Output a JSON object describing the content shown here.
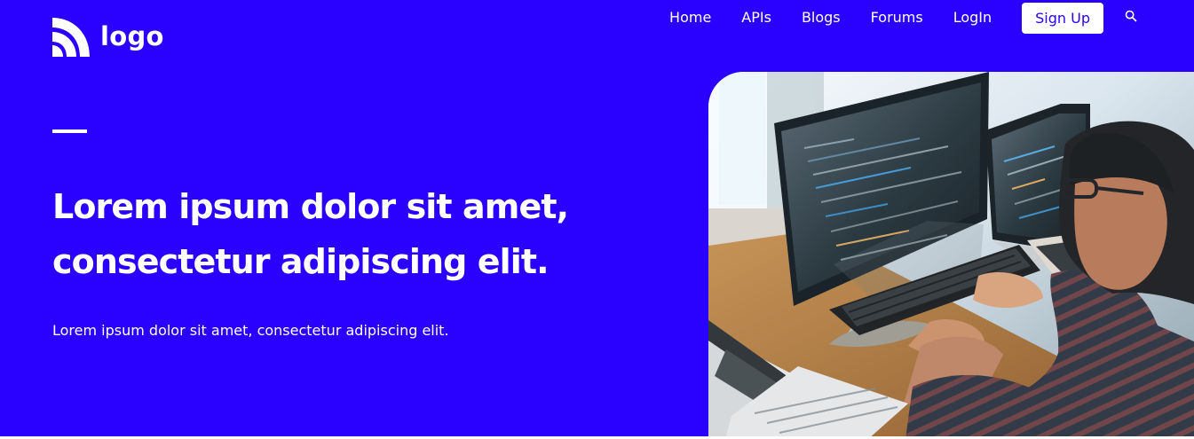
{
  "brand": {
    "logo_text": "logo",
    "logo_icon": "wifi-wave-logo-icon",
    "accent_color": "#2a00ff",
    "text_color": "#ffffff"
  },
  "nav": {
    "items": [
      {
        "label": "Home"
      },
      {
        "label": "APIs"
      },
      {
        "label": "Blogs"
      },
      {
        "label": "Forums"
      },
      {
        "label": "LogIn"
      }
    ],
    "signup_label": "Sign Up",
    "search_icon": "search-icon"
  },
  "hero": {
    "headline": "Lorem ipsum dolor sit amet, consectetur adipiscing elit.",
    "subtext": "Lorem ipsum dolor sit amet, consectetur adipiscing elit.",
    "image_description_name": "developer-at-computers-image"
  }
}
